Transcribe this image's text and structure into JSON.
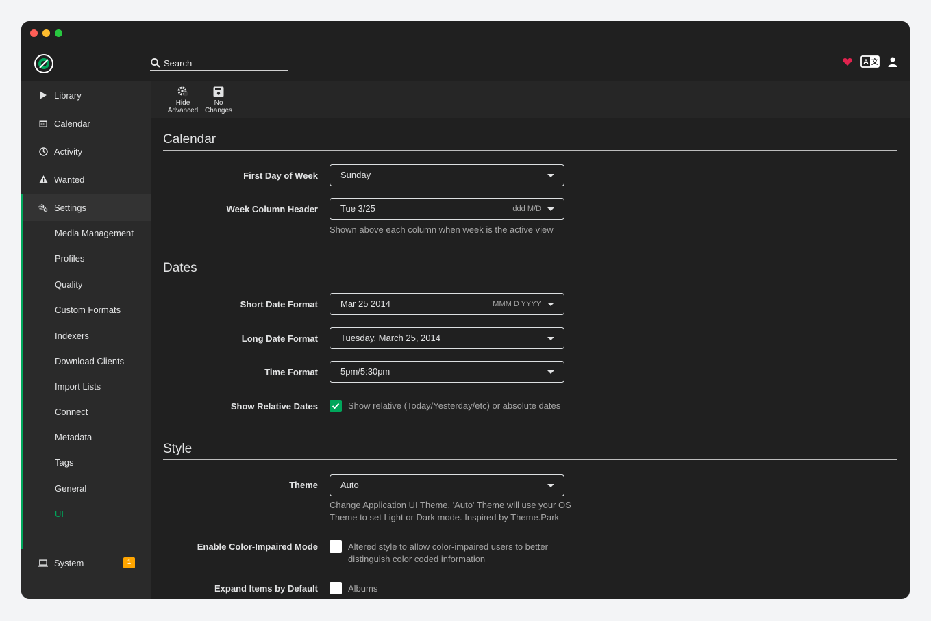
{
  "window": {
    "controls": [
      "close",
      "minimize",
      "maximize"
    ]
  },
  "header": {
    "search_placeholder": "Search",
    "icons": [
      "heart-icon",
      "translate-icon",
      "user-icon"
    ]
  },
  "sidebar": {
    "items": [
      {
        "label": "Library",
        "icon": "play-icon"
      },
      {
        "label": "Calendar",
        "icon": "calendar-icon"
      },
      {
        "label": "Activity",
        "icon": "clock-icon"
      },
      {
        "label": "Wanted",
        "icon": "warning-icon"
      },
      {
        "label": "Settings",
        "icon": "cogs-icon"
      },
      {
        "label": "System",
        "icon": "laptop-icon",
        "badge": "1"
      }
    ],
    "settings_sub": [
      "Media Management",
      "Profiles",
      "Quality",
      "Custom Formats",
      "Indexers",
      "Download Clients",
      "Import Lists",
      "Connect",
      "Metadata",
      "Tags",
      "General",
      "UI"
    ]
  },
  "toolbar": {
    "advanced": {
      "line1": "Hide",
      "line2": "Advanced"
    },
    "save": {
      "line1": "No",
      "line2": "Changes"
    }
  },
  "sections": {
    "calendar": {
      "title": "Calendar",
      "first_day_label": "First Day of Week",
      "first_day_value": "Sunday",
      "week_header_label": "Week Column Header",
      "week_header_value": "Tue 3/25",
      "week_header_hint": "ddd M/D",
      "week_header_help": "Shown above each column when week is the active view"
    },
    "dates": {
      "title": "Dates",
      "short_label": "Short Date Format",
      "short_value": "Mar 25 2014",
      "short_hint": "MMM D YYYY",
      "long_label": "Long Date Format",
      "long_value": "Tuesday, March 25, 2014",
      "time_label": "Time Format",
      "time_value": "5pm/5:30pm",
      "relative_label": "Show Relative Dates",
      "relative_text": "Show relative (Today/Yesterday/etc) or absolute dates",
      "relative_checked": true
    },
    "style": {
      "title": "Style",
      "theme_label": "Theme",
      "theme_value": "Auto",
      "theme_help_1": "Change Application UI Theme, 'Auto' Theme will use your OS",
      "theme_help_2": "Theme to set Light or Dark mode. Inspired by Theme.Park",
      "color_label": "Enable Color-Impaired Mode",
      "color_text_1": "Altered style to allow color-impaired users to better",
      "color_text_2": "distinguish color coded information",
      "color_checked": false,
      "expand_label": "Expand Items by Default",
      "expand_text": "Albums",
      "expand_checked": false
    }
  },
  "colors": {
    "accent": "#00a65b",
    "badge": "#ffa500",
    "heart": "#e0234e"
  }
}
